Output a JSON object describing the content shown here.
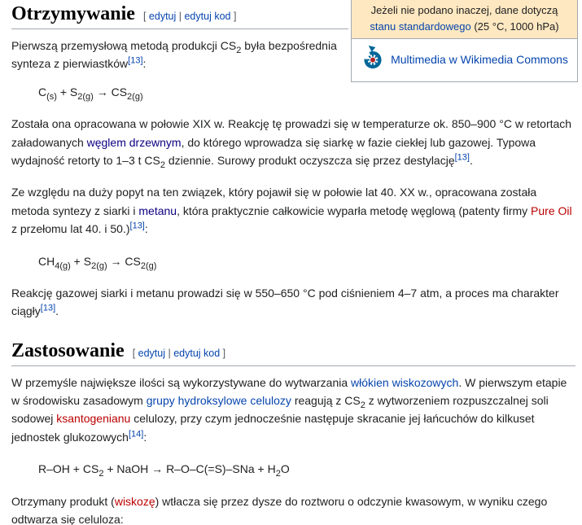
{
  "colors": {
    "link": "#0645ad",
    "visited_link": "#0b0080",
    "red_link": "#ba0000",
    "border": "#a2a9b1",
    "caption_bg": "#fee8c1",
    "commons_blue": "#006699",
    "commons_red": "#b22222"
  },
  "ui": {
    "bracket_open": "[ ",
    "pipe": " | ",
    "bracket_close": " ]"
  },
  "sections": [
    {
      "title": "Otrzymywanie",
      "edit_label": "edytuj",
      "editcode_label": "edytuj kod"
    },
    {
      "title": "Zastosowanie",
      "edit_label": "edytuj",
      "editcode_label": "edytuj kod"
    }
  ],
  "infobox": {
    "note_text": "Jeżeli nie podano inaczej, dane dotyczą ",
    "note_link": "stanu standardowego",
    "note_suffix": " (25 °C, 1000 hPa)",
    "commons_icon": "wikimedia-commons-logo",
    "commons_label": "Multimedia w Wikimedia Commons"
  },
  "content": {
    "p1": [
      {
        "t": "Pierwszą przemysłową metodą produkcji CS"
      },
      {
        "t": "2",
        "s": "sub"
      },
      {
        "t": " była bezpośrednia synteza z pierwiastków"
      },
      {
        "t": "[13]",
        "s": "sup"
      },
      {
        "t": ":"
      }
    ],
    "eq1": [
      {
        "t": "C"
      },
      {
        "t": "(s)",
        "s": "sub"
      },
      {
        "t": " + S"
      },
      {
        "t": "2(g)",
        "s": "sub"
      },
      {
        "t": " → CS"
      },
      {
        "t": "2(g)",
        "s": "sub"
      }
    ],
    "p2": [
      {
        "t": "Została ona opracowana w połowie XIX w. Reakcję tę prowadzi się w temperaturze ok. 850–900 °C w retortach załadowanych "
      },
      {
        "t": "węglem drzewnym",
        "s": "visited"
      },
      {
        "t": ", do którego wprowadza się siarkę w fazie ciekłej lub gazowej. Typowa wydajność retorty to 1–3 t CS"
      },
      {
        "t": "2",
        "s": "sub"
      },
      {
        "t": " dziennie. Surowy produkt oczyszcza się przez destylację"
      },
      {
        "t": "[13]",
        "s": "sup"
      },
      {
        "t": "."
      }
    ],
    "p3": [
      {
        "t": "Ze względu na duży popyt na ten związek, który pojawił się w połowie lat 40. XX w., opracowana została metoda syntezy z siarki i "
      },
      {
        "t": "metanu",
        "s": "visited"
      },
      {
        "t": ", która praktycznie całkowicie wyparła metodę węglową (patenty firmy "
      },
      {
        "t": "Pure Oil",
        "s": "red"
      },
      {
        "t": " z przełomu lat 40. i 50.)"
      },
      {
        "t": "[13]",
        "s": "sup"
      },
      {
        "t": ":"
      }
    ],
    "eq2": [
      {
        "t": "CH"
      },
      {
        "t": "4(g)",
        "s": "sub"
      },
      {
        "t": " + S"
      },
      {
        "t": "2(g)",
        "s": "sub"
      },
      {
        "t": " → CS"
      },
      {
        "t": "2(g)",
        "s": "sub"
      }
    ],
    "p4": [
      {
        "t": "Reakcję gazowej siarki i metanu prowadzi się w 550–650 °C pod ciśnieniem 4–7 atm, a proces ma charakter ciągły"
      },
      {
        "t": "[13]",
        "s": "sup"
      },
      {
        "t": "."
      }
    ],
    "p5": [
      {
        "t": "W przemyśle największe ilości są wykorzystywane do wytwarzania "
      },
      {
        "t": "włókien wiskozowych",
        "s": "link"
      },
      {
        "t": ". W pierwszym etapie w środowisku zasadowym "
      },
      {
        "t": "grupy hydroksylowe celulozy",
        "s": "link"
      },
      {
        "t": " reagują z CS"
      },
      {
        "t": "2",
        "s": "sub"
      },
      {
        "t": " z wytworzeniem rozpuszczalnej soli sodowej "
      },
      {
        "t": "ksantogenianu",
        "s": "red"
      },
      {
        "t": " celulozy, przy czym jednocześnie następuje skracanie jej łańcuchów do kilkuset jednostek glukozowych"
      },
      {
        "t": "[14]",
        "s": "sup"
      },
      {
        "t": ":"
      }
    ],
    "eq3": [
      {
        "t": "R–OH + CS"
      },
      {
        "t": "2",
        "s": "sub"
      },
      {
        "t": " + NaOH → R–O–C(=S)–SNa + H"
      },
      {
        "t": "2",
        "s": "sub"
      },
      {
        "t": "O"
      }
    ],
    "p6": [
      {
        "t": "Otrzymany produkt ("
      },
      {
        "t": "wiskozę",
        "s": "red"
      },
      {
        "t": ") wtłacza się przez dysze do roztworu o odczynie kwasowym, w wyniku czego odtwarza się celuloza:"
      }
    ]
  }
}
